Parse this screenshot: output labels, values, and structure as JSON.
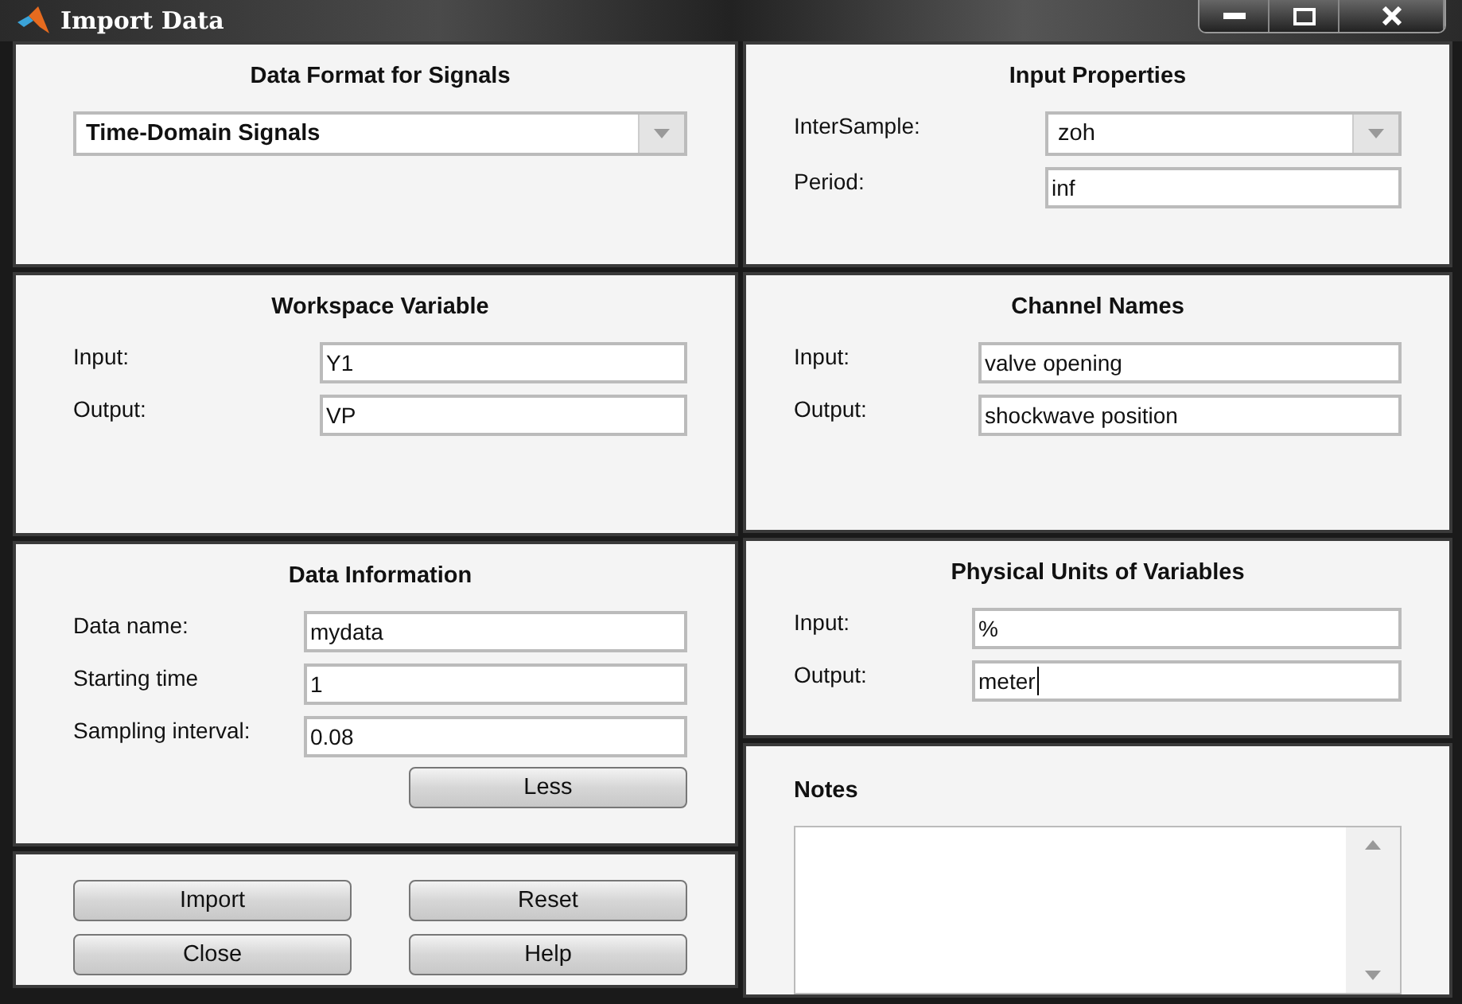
{
  "window": {
    "title": "Import Data"
  },
  "left_column": [
    {
      "kind": "form",
      "title": "Data Format for Signals",
      "rows": [
        {
          "kind": "dropdown",
          "value": "Time-Domain Signals"
        }
      ]
    },
    {
      "kind": "form",
      "title": "Workspace Variable",
      "rows": [
        {
          "kind": "text",
          "label": "Input:",
          "value": "Y1"
        },
        {
          "kind": "text",
          "label": "Output:",
          "value": "VP"
        }
      ]
    },
    {
      "kind": "form",
      "title": "Data Information",
      "rows": [
        {
          "kind": "text",
          "label": "Data name:",
          "value": "mydata"
        },
        {
          "kind": "text",
          "label": "Starting time",
          "value": "1"
        },
        {
          "kind": "text",
          "label": "Sampling interval:",
          "value": "0.08"
        }
      ],
      "button": "Less"
    },
    {
      "kind": "buttons",
      "buttons": [
        "Import",
        "Reset",
        "Close",
        "Help"
      ]
    }
  ],
  "right_column": [
    {
      "kind": "form",
      "title": "Input Properties",
      "rows": [
        {
          "kind": "dropdown",
          "label": "InterSample:",
          "value": "zoh"
        },
        {
          "kind": "text",
          "label": "Period:",
          "value": "inf"
        }
      ]
    },
    {
      "kind": "form",
      "title": "Channel Names",
      "rows": [
        {
          "kind": "text",
          "label": "Input:",
          "value": "valve opening"
        },
        {
          "kind": "text",
          "label": "Output:",
          "value": "shockwave position"
        }
      ]
    },
    {
      "kind": "form",
      "title": "Physical Units of Variables",
      "rows": [
        {
          "kind": "text",
          "label": "Input:",
          "value": "%"
        },
        {
          "kind": "text",
          "label": "Output:",
          "value": "meter",
          "focused": true
        }
      ]
    },
    {
      "kind": "notes",
      "title": "Notes"
    }
  ]
}
